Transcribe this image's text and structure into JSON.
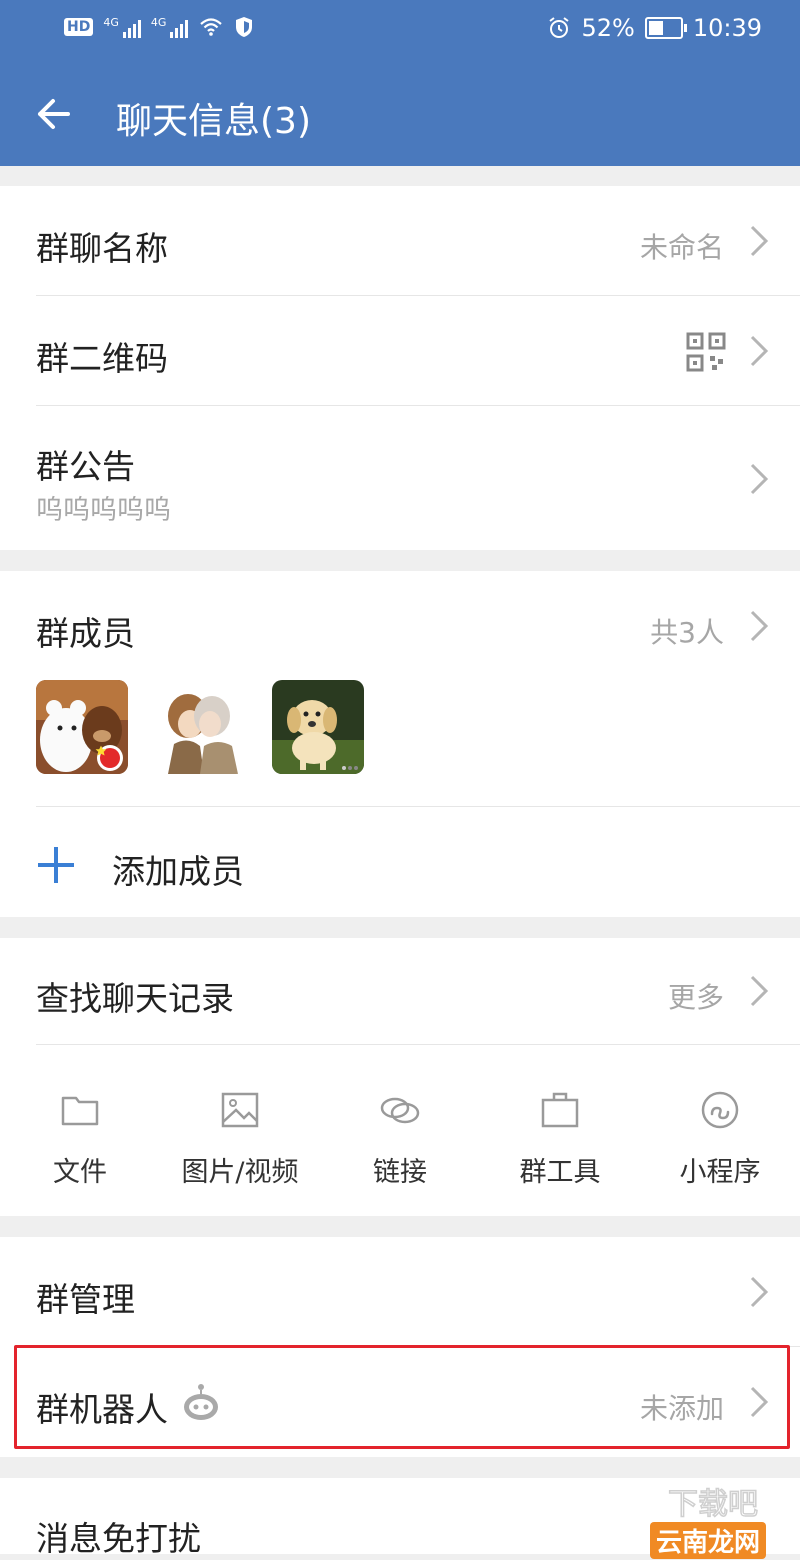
{
  "status_bar": {
    "hd_label": "HD",
    "sim1_label": "4G",
    "sim2_label": "4G",
    "battery_text": "52%",
    "battery_level": 0.52,
    "time": "10:39"
  },
  "header": {
    "title": "聊天信息(3)",
    "background_color": "#4a79bd"
  },
  "sections": {
    "group_name": {
      "label": "群聊名称",
      "value": "未命名"
    },
    "group_qr": {
      "label": "群二维码",
      "icon": "qr-code-icon"
    },
    "group_notice": {
      "label": "群公告",
      "content": "呜呜呜呜呜"
    },
    "members": {
      "label": "群成员",
      "count_text": "共3人",
      "avatars": [
        "avatar-bears",
        "avatar-couple",
        "avatar-puppy"
      ],
      "add_label": "添加成员",
      "accent_color": "#3a7fd5"
    },
    "search_history": {
      "label": "查找聊天记录",
      "more_label": "更多",
      "tools": [
        {
          "label": "文件",
          "icon": "folder-icon"
        },
        {
          "label": "图片/视频",
          "icon": "image-icon"
        },
        {
          "label": "链接",
          "icon": "link-icon"
        },
        {
          "label": "群工具",
          "icon": "briefcase-icon"
        },
        {
          "label": "小程序",
          "icon": "mini-program-icon"
        }
      ]
    },
    "group_manage": {
      "label": "群管理"
    },
    "group_robot": {
      "label": "群机器人",
      "value": "未添加",
      "highlight_color": "#e3232c"
    },
    "do_not_disturb": {
      "label": "消息免打扰"
    }
  },
  "watermark": {
    "text": "云南龙网"
  }
}
